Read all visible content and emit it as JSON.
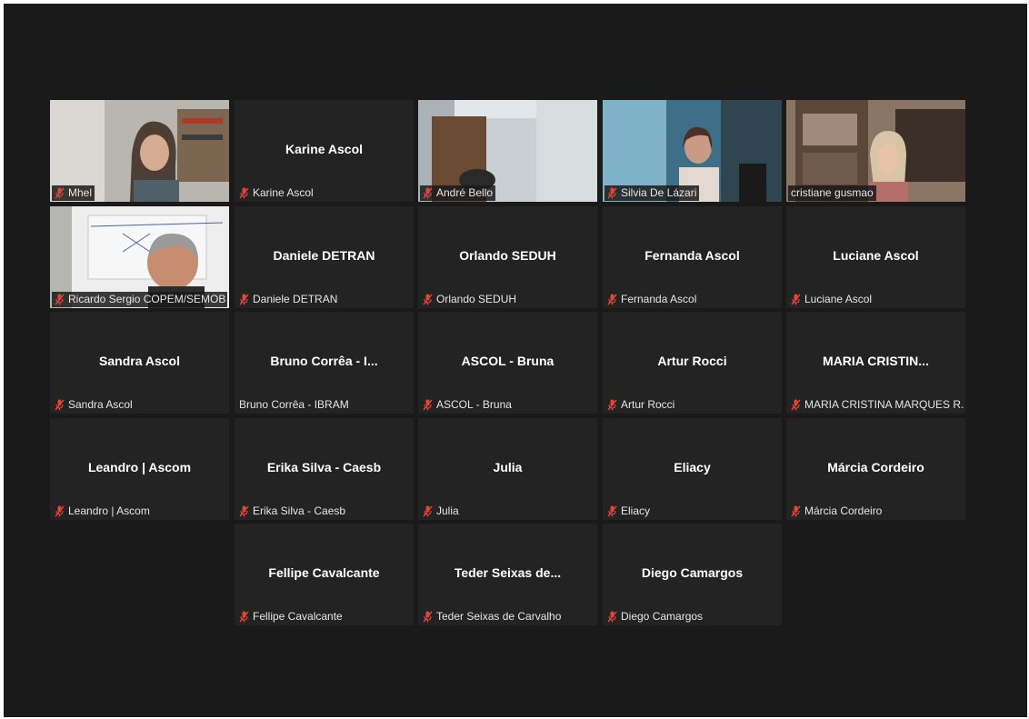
{
  "participants": [
    {
      "name": "Mhel",
      "display": "",
      "muted": true,
      "video": true
    },
    {
      "name": "Karine Ascol",
      "display": "Karine Ascol",
      "muted": true,
      "video": false
    },
    {
      "name": "André Bello",
      "display": "",
      "muted": true,
      "video": true
    },
    {
      "name": "Silvia De Lázari",
      "display": "",
      "muted": true,
      "video": true
    },
    {
      "name": "cristiane gusmao",
      "display": "",
      "muted": false,
      "video": true,
      "active_speaker": true
    },
    {
      "name": "Ricardo Sergio COPEM/SEMOB",
      "display": "",
      "muted": true,
      "video": true
    },
    {
      "name": "Daniele DETRAN",
      "display": "Daniele DETRAN",
      "muted": true,
      "video": false
    },
    {
      "name": "Orlando SEDUH",
      "display": "Orlando SEDUH",
      "muted": true,
      "video": false
    },
    {
      "name": "Fernanda Ascol",
      "display": "Fernanda Ascol",
      "muted": true,
      "video": false
    },
    {
      "name": "Luciane Ascol",
      "display": "Luciane Ascol",
      "muted": true,
      "video": false
    },
    {
      "name": "Sandra Ascol",
      "display": "Sandra Ascol",
      "muted": true,
      "video": false
    },
    {
      "name": "Bruno Corrêa - IBRAM",
      "display": "Bruno Corrêa - I...",
      "muted": false,
      "video": false
    },
    {
      "name": "ASCOL - Bruna",
      "display": "ASCOL - Bruna",
      "muted": true,
      "video": false
    },
    {
      "name": "Artur Rocci",
      "display": "Artur Rocci",
      "muted": true,
      "video": false
    },
    {
      "name": "MARIA CRISTINA MARQUES R...",
      "display": "MARIA CRISTIN...",
      "muted": true,
      "video": false
    },
    {
      "name": "Leandro | Ascom",
      "display": "Leandro | Ascom",
      "muted": true,
      "video": false
    },
    {
      "name": "Erika Silva - Caesb",
      "display": "Erika Silva - Caesb",
      "muted": true,
      "video": false
    },
    {
      "name": "Julia",
      "display": "Julia",
      "muted": true,
      "video": false
    },
    {
      "name": "Eliacy",
      "display": "Eliacy",
      "muted": true,
      "video": false
    },
    {
      "name": "Márcia Cordeiro",
      "display": "Márcia Cordeiro",
      "muted": true,
      "video": false
    },
    {
      "name": "Fellipe Cavalcante",
      "display": "Fellipe Cavalcante",
      "muted": true,
      "video": false
    },
    {
      "name": "Teder Seixas de Carvalho",
      "display": "Teder Seixas de...",
      "muted": true,
      "video": false
    },
    {
      "name": "Diego Camargos",
      "display": "Diego Camargos",
      "muted": true,
      "video": false
    }
  ],
  "colors": {
    "background": "#1a1a1a",
    "tile": "#232323",
    "active_border": "#d6e07a",
    "muted_icon": "#e0453a"
  },
  "icons": {
    "muted": "mic-muted-icon"
  }
}
